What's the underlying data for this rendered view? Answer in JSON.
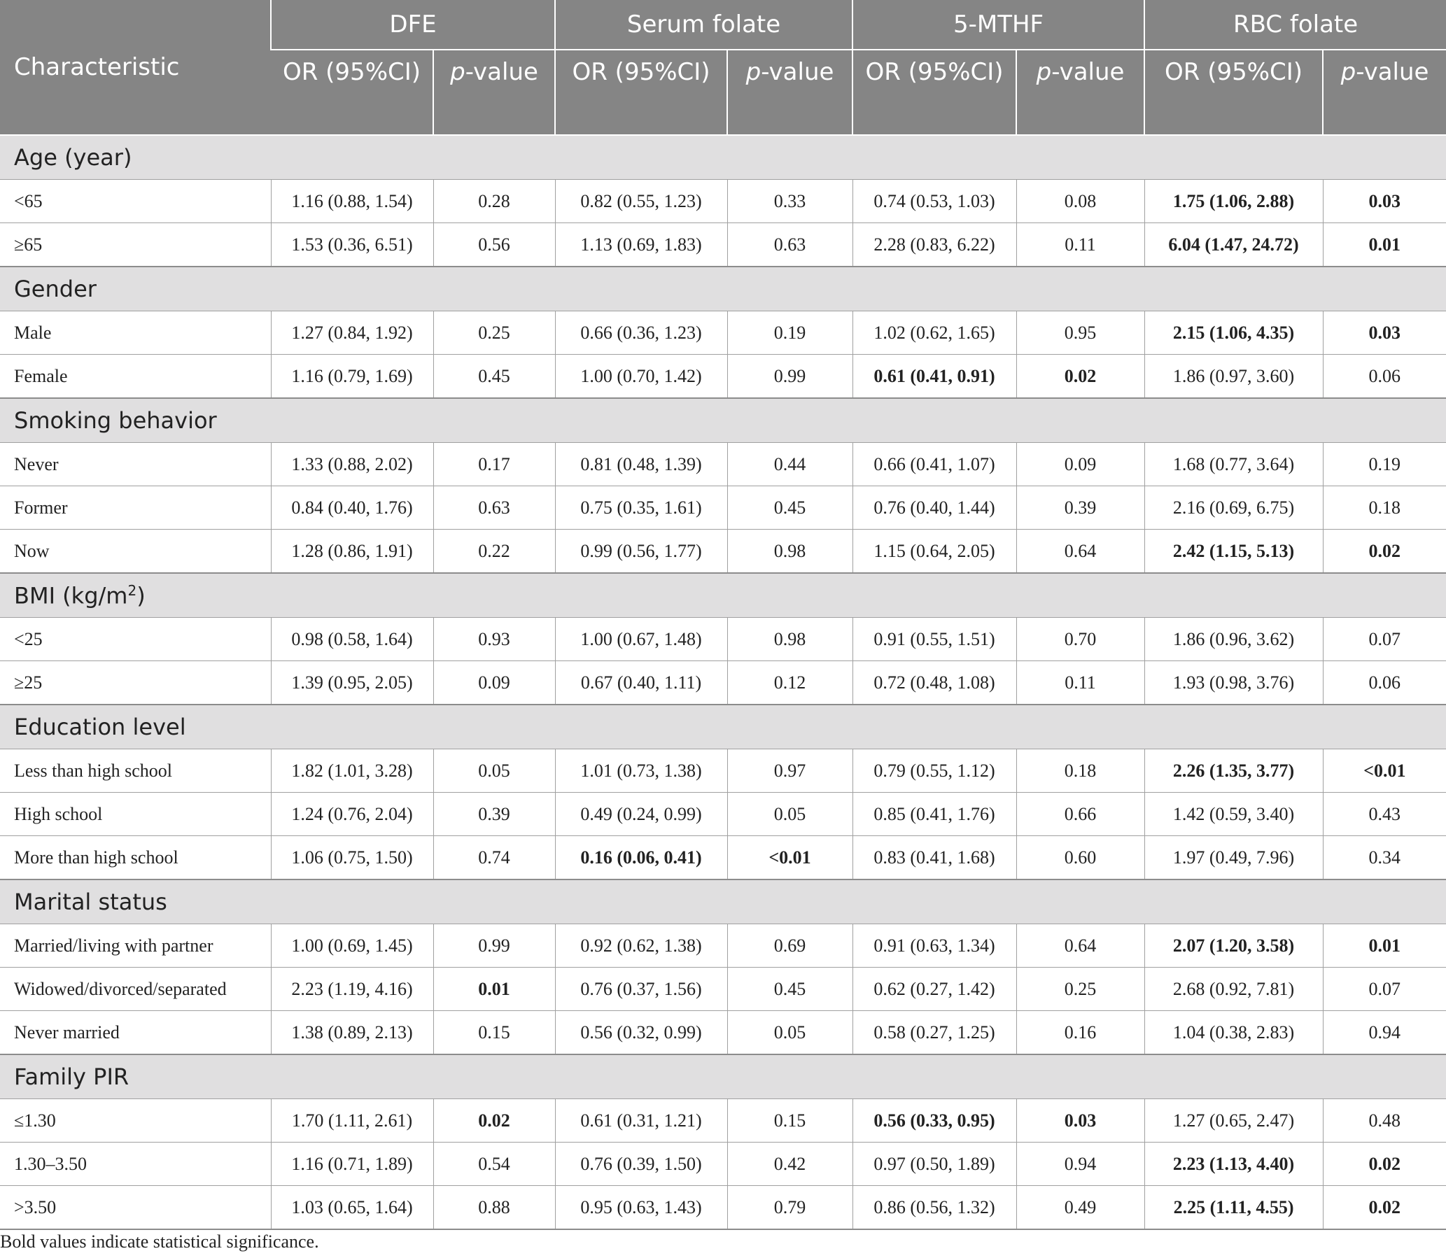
{
  "header": {
    "characteristic": "Characteristic",
    "groups": [
      "DFE",
      "Serum folate",
      "5-MTHF",
      "RBC folate"
    ],
    "or_labels": [
      "OR (95%CI)",
      "OR (95%CI)",
      "OR (95%CI)",
      "OR (95%CI)"
    ],
    "p_prefix": "p",
    "p_suffix": "-value"
  },
  "sections": [
    {
      "title": "Age (year)",
      "rows": [
        {
          "label": "<65",
          "cells": [
            "1.16 (0.88, 1.54)",
            "0.28",
            "0.82 (0.55, 1.23)",
            "0.33",
            "0.74 (0.53, 1.03)",
            "0.08",
            "1.75 (1.06, 2.88)",
            "0.03"
          ],
          "bold": [
            6,
            7
          ]
        },
        {
          "label": "≥65",
          "cells": [
            "1.53 (0.36, 6.51)",
            "0.56",
            "1.13 (0.69, 1.83)",
            "0.63",
            "2.28 (0.83, 6.22)",
            "0.11",
            "6.04 (1.47, 24.72)",
            "0.01"
          ],
          "bold": [
            6,
            7
          ]
        }
      ]
    },
    {
      "title": "Gender",
      "rows": [
        {
          "label": "Male",
          "cells": [
            "1.27 (0.84, 1.92)",
            "0.25",
            "0.66 (0.36, 1.23)",
            "0.19",
            "1.02 (0.62, 1.65)",
            "0.95",
            "2.15 (1.06, 4.35)",
            "0.03"
          ],
          "bold": [
            6,
            7
          ]
        },
        {
          "label": "Female",
          "cells": [
            "1.16 (0.79, 1.69)",
            "0.45",
            "1.00 (0.70, 1.42)",
            "0.99",
            "0.61 (0.41, 0.91)",
            "0.02",
            "1.86 (0.97, 3.60)",
            "0.06"
          ],
          "bold": [
            4,
            5
          ]
        }
      ]
    },
    {
      "title": "Smoking behavior",
      "rows": [
        {
          "label": "Never",
          "cells": [
            "1.33 (0.88, 2.02)",
            "0.17",
            "0.81 (0.48, 1.39)",
            "0.44",
            "0.66 (0.41, 1.07)",
            "0.09",
            "1.68 (0.77, 3.64)",
            "0.19"
          ],
          "bold": []
        },
        {
          "label": "Former",
          "cells": [
            "0.84 (0.40, 1.76)",
            "0.63",
            "0.75 (0.35, 1.61)",
            "0.45",
            "0.76 (0.40, 1.44)",
            "0.39",
            "2.16 (0.69, 6.75)",
            "0.18"
          ],
          "bold": []
        },
        {
          "label": "Now",
          "cells": [
            "1.28 (0.86, 1.91)",
            "0.22",
            "0.99 (0.56, 1.77)",
            "0.98",
            "1.15 (0.64, 2.05)",
            "0.64",
            "2.42 (1.15, 5.13)",
            "0.02"
          ],
          "bold": [
            6,
            7
          ]
        }
      ]
    },
    {
      "title": "BMI (kg/m",
      "title_sup": "2",
      "title_end": ")",
      "rows": [
        {
          "label": "<25",
          "cells": [
            "0.98 (0.58, 1.64)",
            "0.93",
            "1.00 (0.67, 1.48)",
            "0.98",
            "0.91 (0.55, 1.51)",
            "0.70",
            "1.86 (0.96, 3.62)",
            "0.07"
          ],
          "bold": []
        },
        {
          "label": "≥25",
          "cells": [
            "1.39 (0.95, 2.05)",
            "0.09",
            "0.67 (0.40, 1.11)",
            "0.12",
            "0.72 (0.48, 1.08)",
            "0.11",
            "1.93 (0.98, 3.76)",
            "0.06"
          ],
          "bold": []
        }
      ]
    },
    {
      "title": "Education level",
      "rows": [
        {
          "label": "Less than high school",
          "cells": [
            "1.82 (1.01, 3.28)",
            "0.05",
            "1.01 (0.73, 1.38)",
            "0.97",
            "0.79 (0.55, 1.12)",
            "0.18",
            "2.26 (1.35, 3.77)",
            "<0.01"
          ],
          "bold": [
            6,
            7
          ]
        },
        {
          "label": "High school",
          "cells": [
            "1.24 (0.76, 2.04)",
            "0.39",
            "0.49 (0.24, 0.99)",
            "0.05",
            "0.85 (0.41, 1.76)",
            "0.66",
            "1.42 (0.59, 3.40)",
            "0.43"
          ],
          "bold": []
        },
        {
          "label": "More than high school",
          "cells": [
            "1.06 (0.75, 1.50)",
            "0.74",
            "0.16 (0.06, 0.41)",
            "<0.01",
            "0.83 (0.41, 1.68)",
            "0.60",
            "1.97 (0.49, 7.96)",
            "0.34"
          ],
          "bold": [
            2,
            3
          ]
        }
      ]
    },
    {
      "title": "Marital status",
      "rows": [
        {
          "label": "Married/living with partner",
          "cells": [
            "1.00 (0.69, 1.45)",
            "0.99",
            "0.92 (0.62, 1.38)",
            "0.69",
            "0.91 (0.63, 1.34)",
            "0.64",
            "2.07 (1.20, 3.58)",
            "0.01"
          ],
          "bold": [
            6,
            7
          ]
        },
        {
          "label": "Widowed/divorced/separated",
          "cells": [
            "2.23 (1.19, 4.16)",
            "0.01",
            "0.76 (0.37, 1.56)",
            "0.45",
            "0.62 (0.27, 1.42)",
            "0.25",
            "2.68 (0.92, 7.81)",
            "0.07"
          ],
          "bold": [
            1
          ]
        },
        {
          "label": "Never married",
          "cells": [
            "1.38 (0.89, 2.13)",
            "0.15",
            "0.56 (0.32, 0.99)",
            "0.05",
            "0.58 (0.27, 1.25)",
            "0.16",
            "1.04 (0.38, 2.83)",
            "0.94"
          ],
          "bold": []
        }
      ]
    },
    {
      "title": "Family PIR",
      "rows": [
        {
          "label": "≤1.30",
          "cells": [
            "1.70 (1.11, 2.61)",
            "0.02",
            "0.61 (0.31, 1.21)",
            "0.15",
            "0.56 (0.33, 0.95)",
            "0.03",
            "1.27 (0.65, 2.47)",
            "0.48"
          ],
          "bold": [
            1,
            4,
            5
          ]
        },
        {
          "label": "1.30–3.50",
          "cells": [
            "1.16 (0.71, 1.89)",
            "0.54",
            "0.76 (0.39, 1.50)",
            "0.42",
            "0.97 (0.50, 1.89)",
            "0.94",
            "2.23 (1.13, 4.40)",
            "0.02"
          ],
          "bold": [
            6,
            7
          ]
        },
        {
          "label": ">3.50",
          "cells": [
            "1.03 (0.65, 1.64)",
            "0.88",
            "0.95 (0.63, 1.43)",
            "0.79",
            "0.86 (0.56, 1.32)",
            "0.49",
            "2.25 (1.11, 4.55)",
            "0.02"
          ],
          "bold": [
            6,
            7
          ]
        }
      ]
    }
  ],
  "footnote": "Bold values indicate statistical significance."
}
